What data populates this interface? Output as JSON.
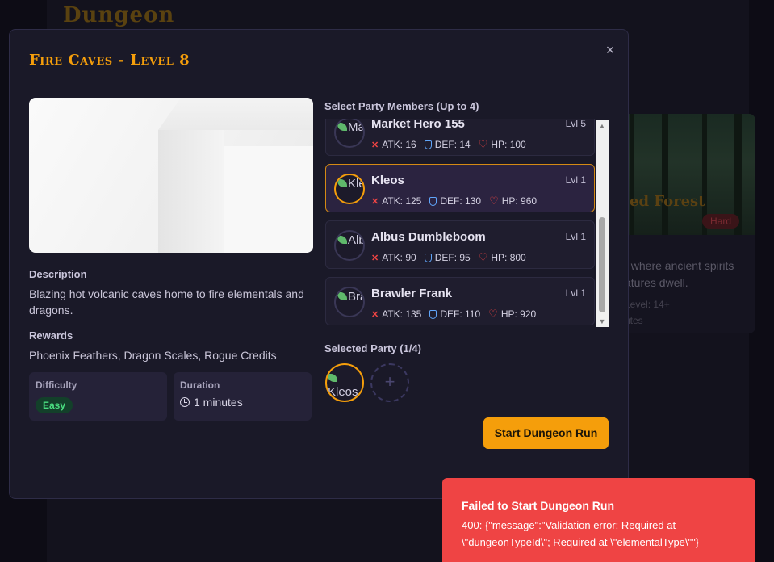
{
  "background": {
    "title": "Dungeon",
    "card": {
      "title": "ed Forest",
      "badge": "Hard",
      "desc_line1": "t where ancient spirits",
      "desc_line2": "atures dwell.",
      "meta_line1": "Level: 14+",
      "meta_line2": "utes"
    }
  },
  "modal": {
    "title": "Fire Caves - Level 8",
    "close_glyph": "×",
    "description_label": "Description",
    "description_text": "Blazing hot volcanic caves home to fire elementals and dragons.",
    "rewards_label": "Rewards",
    "rewards_text": "Phoenix Feathers, Dragon Scales, Rogue Credits",
    "difficulty_label": "Difficulty",
    "difficulty_value": "Easy",
    "duration_label": "Duration",
    "duration_value": "1 minutes",
    "party_label": "Select Party Members (Up to 4)",
    "members": [
      {
        "name": "Market Hero 155",
        "level": "Lvl 5",
        "avatar_alt": "Mark",
        "atk": "ATK: 16",
        "def": "DEF: 14",
        "hp": "HP: 100",
        "selected": false
      },
      {
        "name": "Kleos",
        "level": "Lvl 1",
        "avatar_alt": "Kleo",
        "atk": "ATK: 125",
        "def": "DEF: 130",
        "hp": "HP: 960",
        "selected": true
      },
      {
        "name": "Albus Dumbleboom",
        "level": "Lvl 1",
        "avatar_alt": "Albu",
        "atk": "ATK: 90",
        "def": "DEF: 95",
        "hp": "HP: 800",
        "selected": false
      },
      {
        "name": "Brawler Frank",
        "level": "Lvl 1",
        "avatar_alt": "Braw",
        "atk": "ATK: 135",
        "def": "DEF: 110",
        "hp": "HP: 920",
        "selected": false
      }
    ],
    "selected_party_label": "Selected Party (1/4)",
    "selected_avatar_alt": "Kleos",
    "add_glyph": "+",
    "start_button": "Start Dungeon Run"
  },
  "toast": {
    "title": "Failed to Start Dungeon Run",
    "body": "400: {\"message\":\"Validation error: Required at \\\"dungeonTypeId\\\"; Required at \\\"elementalType\\\"\"}"
  },
  "colors": {
    "accent": "#f59e0b",
    "error": "#ef4444",
    "easy": "#4ade80",
    "modal_bg": "#1a1928"
  }
}
